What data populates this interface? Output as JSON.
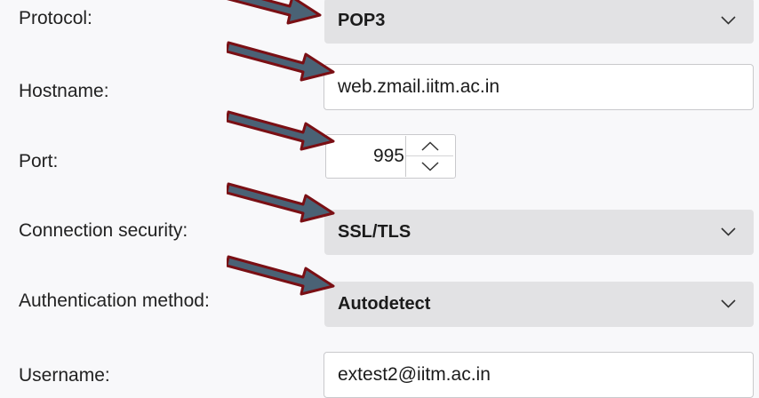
{
  "form": {
    "protocol": {
      "label": "Protocol:",
      "value": "POP3"
    },
    "hostname": {
      "label": "Hostname:",
      "value": "web.zmail.iitm.ac.in"
    },
    "port": {
      "label": "Port:",
      "value": "995"
    },
    "connection_security": {
      "label": "Connection security:",
      "value": "SSL/TLS"
    },
    "authentication_method": {
      "label": "Authentication method:",
      "value": "Autodetect"
    },
    "username": {
      "label": "Username:",
      "value": "extest2@iitm.ac.in"
    }
  },
  "icons": {
    "dropdown": "chevron-down-icon",
    "spin_up": "chevron-up-icon",
    "spin_down": "chevron-down-icon",
    "annotation": "arrow-annotation-icon"
  },
  "colors": {
    "background": "#f8f8fa",
    "dropdown_bg": "#e2e2e4",
    "field_bg": "#ffffff",
    "field_border": "#c9c9cc",
    "arrow_fill": "#4a6275",
    "arrow_outline": "#7a0f14"
  }
}
